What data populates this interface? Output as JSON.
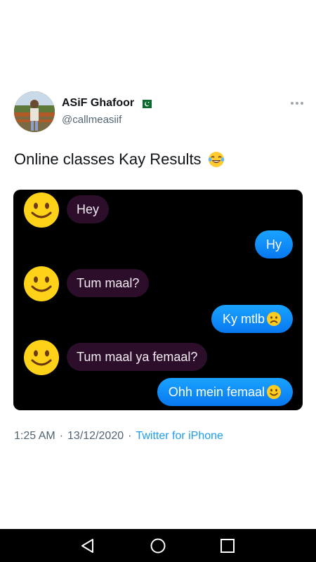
{
  "tweet": {
    "display_name": "ASiF Ghafoor",
    "handle": "@callmeasiif",
    "text": "Online classes Kay Results",
    "text_emoji": "laughing-tears-emoji",
    "flag": "pakistan-flag",
    "time": "1:25 AM",
    "date": "13/12/2020",
    "separator": "·",
    "source": "Twitter for iPhone"
  },
  "chat": {
    "messages": [
      {
        "side": "incoming",
        "text": "Hey"
      },
      {
        "side": "outgoing",
        "text": "Hy"
      },
      {
        "side": "incoming",
        "text": "Tum maal?"
      },
      {
        "side": "outgoing",
        "text": "Ky mtlb",
        "emoji": "confused-face-emoji"
      },
      {
        "side": "incoming",
        "text": "Tum maal ya femaal?"
      },
      {
        "side": "outgoing",
        "text": "Ohh mein femaal",
        "emoji": "smiling-face-emoji"
      }
    ]
  },
  "colors": {
    "link": "#1d9bf0",
    "incoming_bubble": "#2c0e2b",
    "outgoing_bubble": "#0a84ff",
    "chat_background": "#000000"
  },
  "nav": {
    "buttons": [
      "back-triangle-icon",
      "home-circle-icon",
      "recents-square-icon"
    ]
  }
}
